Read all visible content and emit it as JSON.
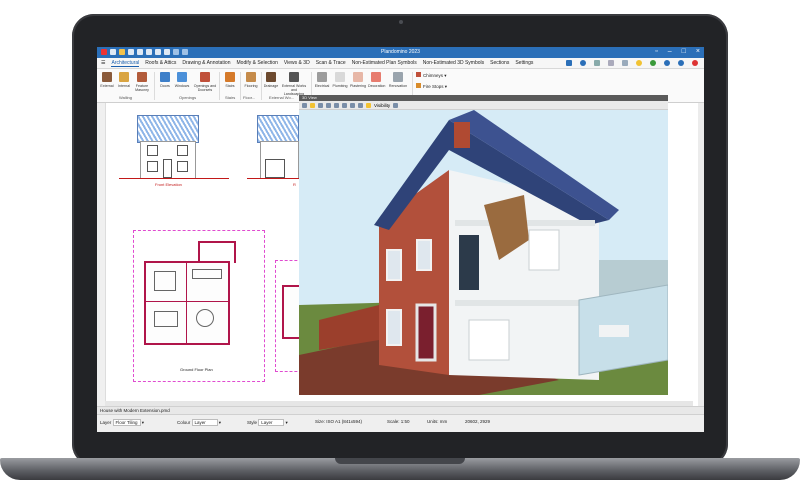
{
  "app": {
    "title": "Plandomino 2023"
  },
  "menu": {
    "tabs": [
      "Architectural",
      "Roofs & Attics",
      "Drawing & Annotation",
      "Modify & Selection",
      "Views & 3D",
      "Scan & Trace",
      "Non-Estimated Plan Symbols",
      "Non-Estimated 3D Symbols",
      "Sections",
      "Settings"
    ],
    "active": "Architectural"
  },
  "ribbon": {
    "walling": {
      "label": "Walling",
      "buttons": [
        "External",
        "Internal",
        "Feature Masonry"
      ]
    },
    "openings": {
      "label": "Openings",
      "buttons": [
        "Doors",
        "Windows",
        "Openings and Doorsets"
      ]
    },
    "stairs": {
      "label": "Stairs",
      "buttons": [
        "Stairs"
      ]
    },
    "floors": {
      "label": "Floor...",
      "buttons": [
        "Flooring"
      ]
    },
    "external": {
      "label": "External Wo...",
      "buttons": [
        "Drainage",
        "External Works and Landscaping"
      ]
    },
    "services": {
      "buttons": [
        "Electrical",
        "Plumbing",
        "Plastering",
        "Decoration",
        "Renovation"
      ]
    },
    "extras": {
      "chimneys": "Chimneys",
      "fire_stops": "Fire Stops"
    }
  },
  "drawing": {
    "front_elevation": "Front Elevation",
    "ground_floor_plan": "Ground Floor Plan",
    "partial_caption": "R"
  },
  "viewer3d": {
    "title": "3D View",
    "visibility_label": "Visibility"
  },
  "file_tab": "House with Modern Extension.pmd",
  "status": {
    "layer_label": "Layer",
    "layer_value": "Floor Tiling",
    "colour_label": "Colour",
    "colour_value": "Layer",
    "style_label": "Style",
    "style_value": "Layer",
    "sheet": "Size: ISO A1 (841x594)",
    "scale": "Scale: 1:50",
    "units": "Units: mm",
    "coords": "20602, 2929"
  },
  "colors": {
    "titlebar": "#2b6fb8",
    "accent": "#1b5fae",
    "plan_outline": "#b0154a",
    "sky": "#d9ecf7"
  }
}
